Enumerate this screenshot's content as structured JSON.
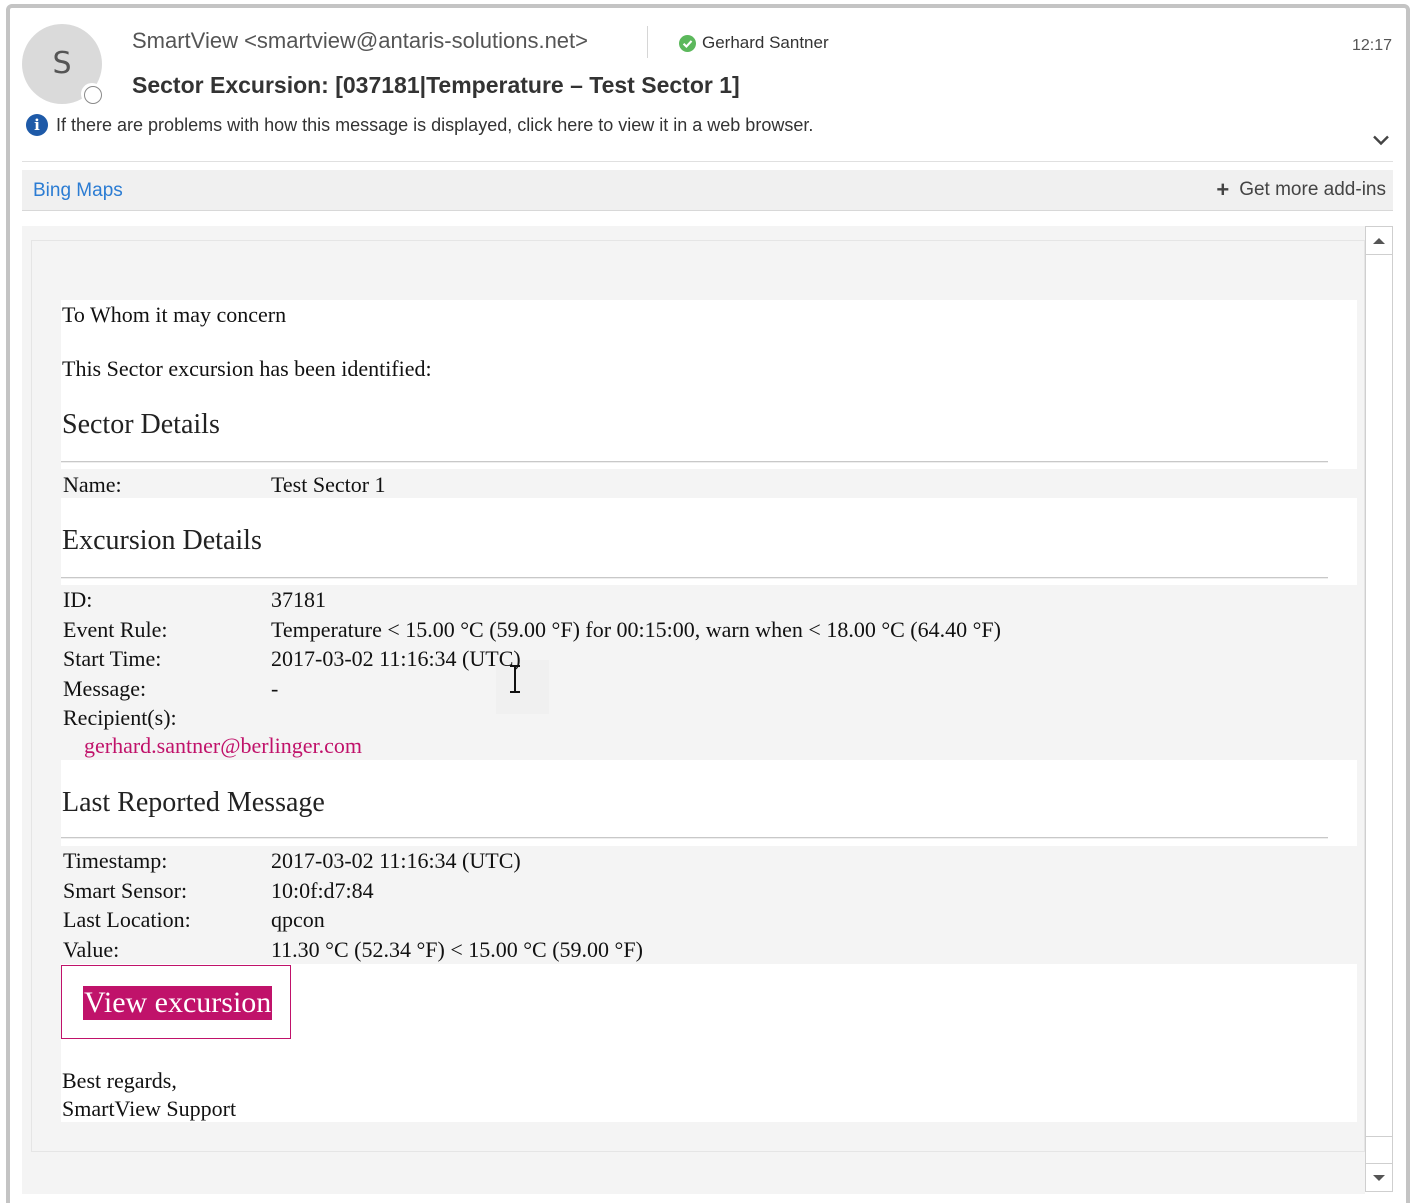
{
  "header": {
    "avatar_initial": "S",
    "sender": "SmartView <smartview@antaris-solutions.net>",
    "recipient": "Gerhard Santner",
    "time": "12:17",
    "subject": "Sector Excursion: [037181|Temperature – Test Sector 1]",
    "info_text": "If there are problems with how this message is displayed, click here to view it in a web browser."
  },
  "addins": {
    "bing_maps": "Bing Maps",
    "get_more": "Get more add-ins"
  },
  "message": {
    "greeting": "To Whom it may concern",
    "intro": "This Sector excursion has been identified:",
    "sector_details": {
      "heading": "Sector Details",
      "name_label": "Name:",
      "name_value": "Test Sector 1"
    },
    "excursion_details": {
      "heading": "Excursion Details",
      "id_label": "ID:",
      "id_value": "37181",
      "rule_label": "Event Rule:",
      "rule_value": "Temperature < 15.00 °C (59.00 °F) for 00:15:00, warn when < 18.00 °C (64.40 °F)",
      "start_label": "Start Time:",
      "start_value": "2017-03-02 11:16:34 (UTC)",
      "message_label": "Message:",
      "message_value": "-",
      "recipients_label": "Recipient(s):",
      "recipient_email": "gerhard.santner@berlinger.com"
    },
    "last_reported": {
      "heading": "Last Reported Message",
      "timestamp_label": "Timestamp:",
      "timestamp_value": "2017-03-02 11:16:34 (UTC)",
      "sensor_label": "Smart Sensor:",
      "sensor_value": "10:0f:d7:84",
      "location_label": "Last Location:",
      "location_value": "qpcon",
      "value_label": "Value:",
      "value_value": "11.30 °C (52.34 °F) < 15.00 °C (59.00 °F)"
    },
    "view_button": "View excursion",
    "closing_1": "Best regards,",
    "closing_2": "SmartView Support"
  },
  "colors": {
    "accent_magenta": "#c0126a",
    "link_blue": "#2b7cd3",
    "presence_green": "#5cb85c",
    "info_blue": "#1e5aa8"
  }
}
